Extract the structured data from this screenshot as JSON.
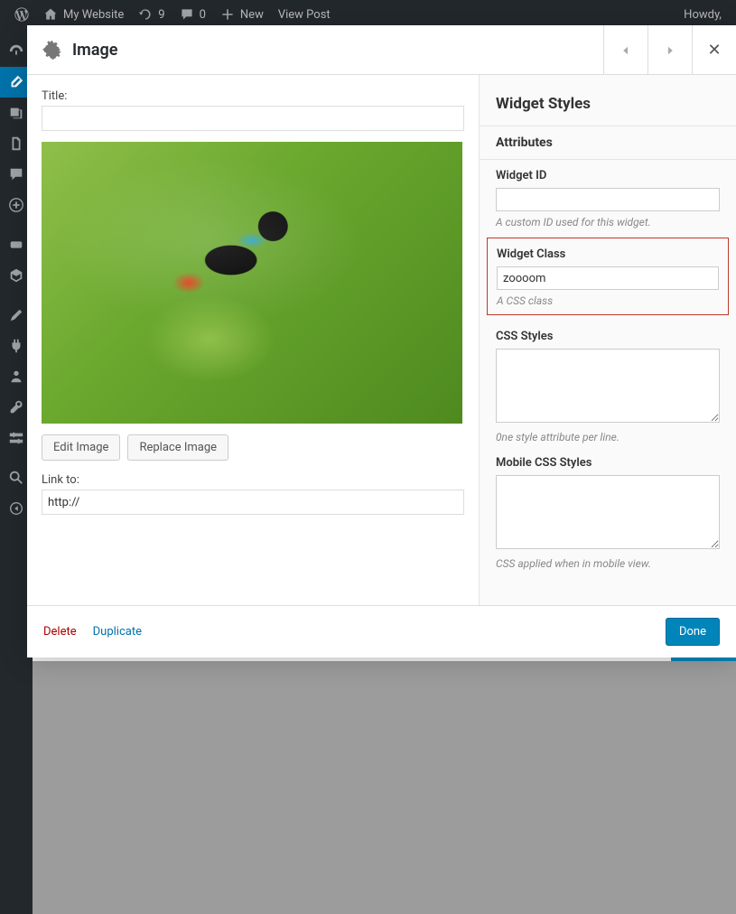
{
  "adminbar": {
    "site_name": "My Website",
    "updates_count": "9",
    "comments_count": "0",
    "new_label": "New",
    "view_post": "View Post",
    "howdy": "Howdy,"
  },
  "modal": {
    "title": "Image",
    "title_label": "Title:",
    "title_value": "",
    "edit_image": "Edit Image",
    "replace_image": "Replace Image",
    "link_to_label": "Link to:",
    "link_to_value": "http://",
    "delete": "Delete",
    "duplicate": "Duplicate",
    "done": "Done"
  },
  "styles": {
    "heading": "Widget Styles",
    "attributes": "Attributes",
    "widget_id_label": "Widget ID",
    "widget_id_value": "",
    "widget_id_hint": "A custom ID used for this widget.",
    "widget_class_label": "Widget Class",
    "widget_class_value": "zoooom",
    "widget_class_hint": "A CSS class",
    "css_label": "CSS Styles",
    "css_value": "",
    "css_hint": "0ne style attribute per line.",
    "mobile_css_label": "Mobile CSS Styles",
    "mobile_css_value": "",
    "mobile_css_hint": "CSS applied when in mobile view."
  }
}
